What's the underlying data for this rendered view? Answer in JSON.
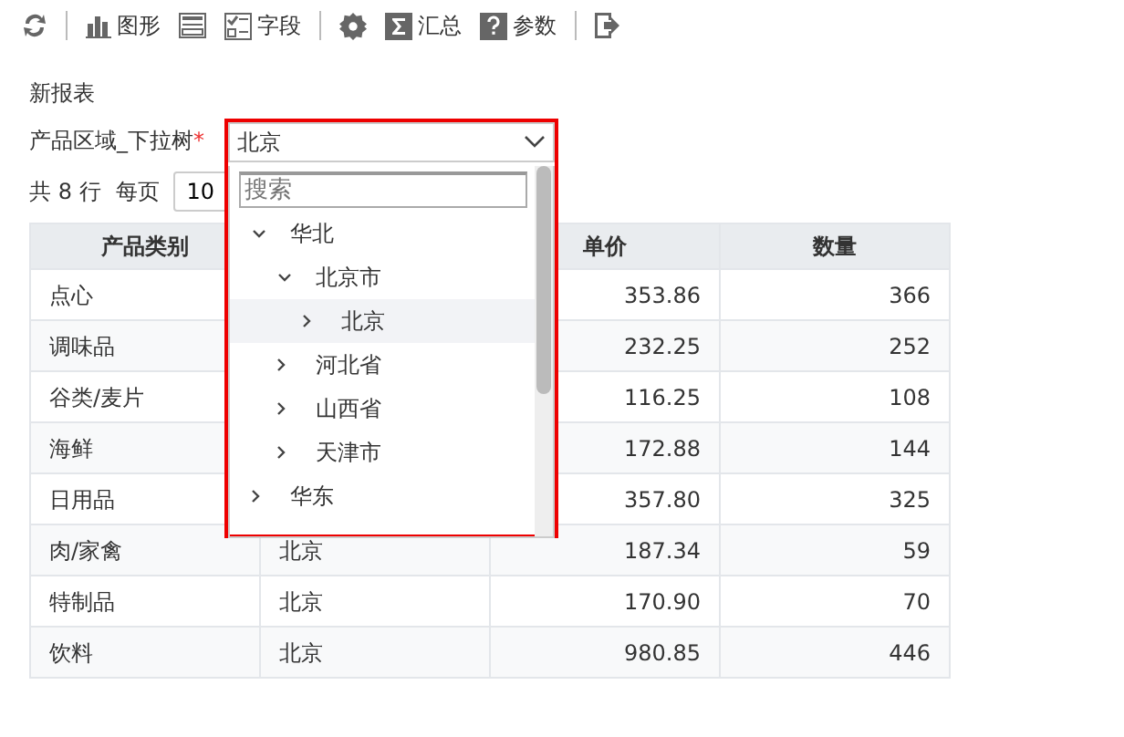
{
  "toolbar": [
    {
      "kind": "refresh"
    },
    {
      "kind": "sep"
    },
    {
      "kind": "chart",
      "label": "图形"
    },
    {
      "kind": "layout"
    },
    {
      "kind": "fields",
      "label": "字段"
    },
    {
      "kind": "sep"
    },
    {
      "kind": "settings"
    },
    {
      "kind": "sum",
      "label": "汇总"
    },
    {
      "kind": "help",
      "label": "参数"
    },
    {
      "kind": "sep"
    },
    {
      "kind": "exit"
    }
  ],
  "report_title": "新报表",
  "parameter": {
    "label": "产品区域_下拉树",
    "required_mark": "*",
    "value": "北京",
    "search": {
      "placeholder": "搜索"
    },
    "tree": [
      {
        "label": "华北",
        "expanded": true,
        "children": [
          {
            "label": "北京市",
            "expanded": true,
            "children": [
              {
                "label": "北京",
                "expanded": false,
                "selected": true
              }
            ]
          },
          {
            "label": "河北省",
            "expanded": false
          },
          {
            "label": "山西省",
            "expanded": false
          },
          {
            "label": "天津市",
            "expanded": false
          }
        ]
      },
      {
        "label": "华东",
        "expanded": false
      }
    ]
  },
  "pager": {
    "total": "共 8 行",
    "per_page_label": "每页",
    "per_page": "10"
  },
  "table": {
    "columns": [
      "产品类别",
      "",
      "单价",
      "数量"
    ],
    "rows": [
      {
        "category": "点心",
        "price": "353.86",
        "qty": "366"
      },
      {
        "category": "调味品",
        "price": "232.25",
        "qty": "252"
      },
      {
        "category": "谷类/麦片",
        "price": "116.25",
        "qty": "108"
      },
      {
        "category": "海鲜",
        "price": "172.88",
        "qty": "144"
      },
      {
        "category": "日用品",
        "price": "357.80",
        "qty": "325"
      },
      {
        "category": "肉/家禽",
        "region": "北京",
        "price": "187.34",
        "qty": "59"
      },
      {
        "category": "特制品",
        "region": "北京",
        "price": "170.90",
        "qty": "70"
      },
      {
        "category": "饮料",
        "region": "北京",
        "price": "980.85",
        "qty": "446"
      }
    ]
  }
}
